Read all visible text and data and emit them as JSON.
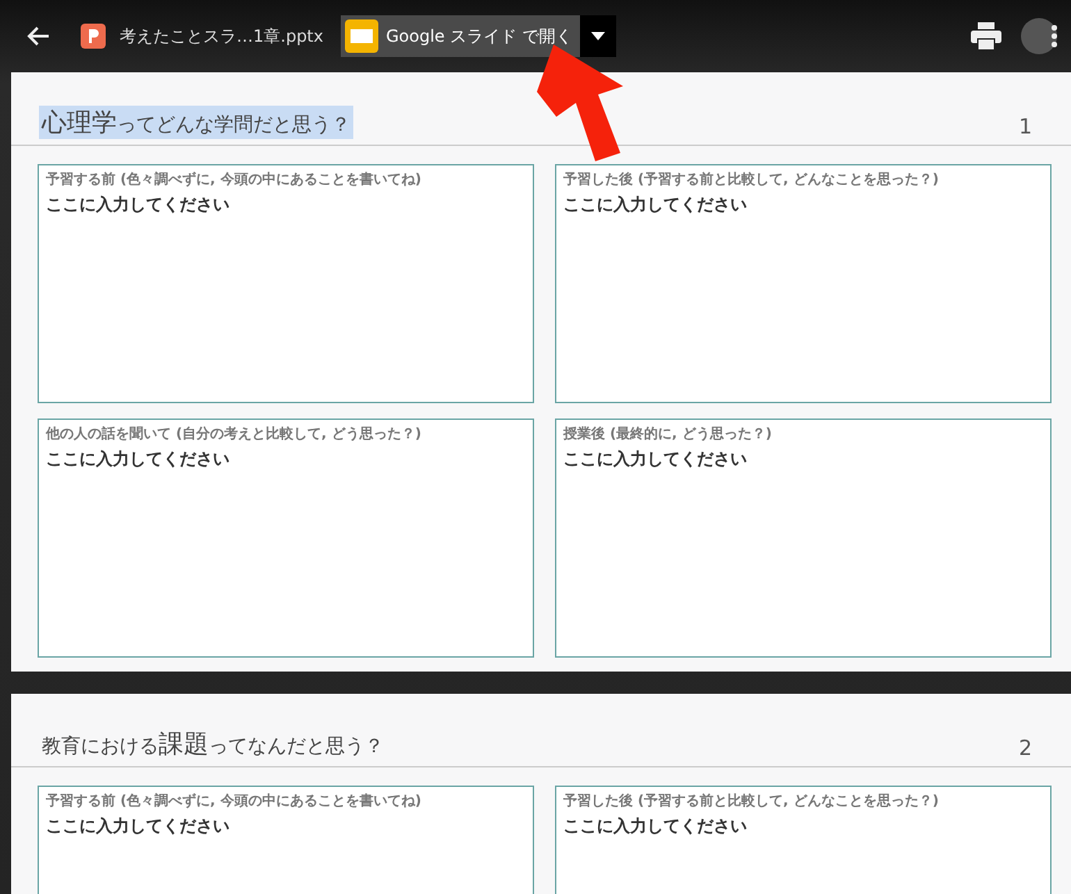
{
  "toolbar": {
    "file_name": "考えたことスラ…1章.pptx",
    "open_button": "Google スライド で開く"
  },
  "slides": [
    {
      "number": "1",
      "title_highlighted": true,
      "title": [
        {
          "text": "心理学",
          "large": true
        },
        {
          "text": "ってどんな学問だと思う？",
          "large": false
        }
      ],
      "boxes": [
        {
          "label": "予習する前 (色々調べずに, 今頭の中にあることを書いてね)",
          "value": "ここに入力してください"
        },
        {
          "label": "予習した後 (予習する前と比較して, どんなことを思った？)",
          "value": "ここに入力してください"
        },
        {
          "label": "他の人の話を聞いて (自分の考えと比較して, どう思った？)",
          "value": "ここに入力してください"
        },
        {
          "label": "授業後 (最終的に, どう思った？)",
          "value": "ここに入力してください"
        }
      ]
    },
    {
      "number": "2",
      "title_highlighted": false,
      "title": [
        {
          "text": "教育における",
          "large": false
        },
        {
          "text": "課題",
          "large": true
        },
        {
          "text": "ってなんだと思う？",
          "large": false
        }
      ],
      "boxes": [
        {
          "label": "予習する前 (色々調べずに, 今頭の中にあることを書いてね)",
          "value": "ここに入力してください"
        },
        {
          "label": "予習した後 (予習する前と比較して, どんなことを思った？)",
          "value": "ここに入力してください"
        }
      ]
    }
  ]
}
